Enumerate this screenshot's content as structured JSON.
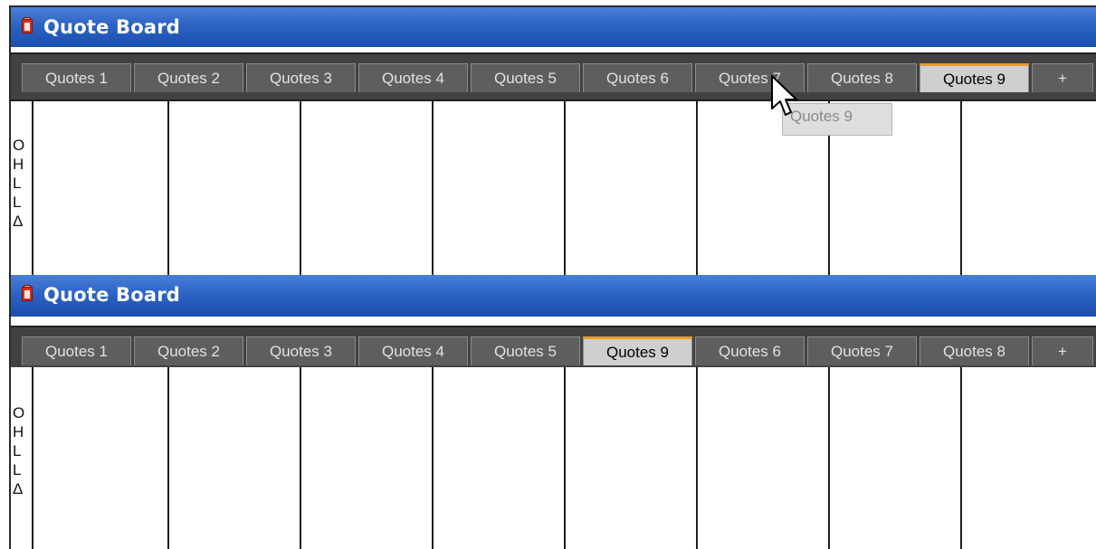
{
  "boards": [
    {
      "title": "Quote Board",
      "tabs": [
        "Quotes 1",
        "Quotes 2",
        "Quotes 3",
        "Quotes 4",
        "Quotes 5",
        "Quotes 6",
        "Quotes 7",
        "Quotes 8",
        "Quotes 9",
        "+"
      ],
      "active_tab": "Quotes 9",
      "row_labels": [
        "O",
        "H",
        "L",
        "L",
        "Δ"
      ]
    },
    {
      "title": "Quote Board",
      "tabs": [
        "Quotes 1",
        "Quotes 2",
        "Quotes 3",
        "Quotes 4",
        "Quotes 5",
        "Quotes 9",
        "Quotes 6",
        "Quotes 7",
        "Quotes 8",
        "+"
      ],
      "active_tab": "Quotes 9",
      "row_labels": [
        "O",
        "H",
        "L",
        "L",
        "Δ"
      ]
    }
  ],
  "drag_ghost_label": "Quotes 9",
  "colors": {
    "titlebar": "#2c63c4",
    "tabstrip": "#424242",
    "tab": "#5e5e5e",
    "tab_active": "#cfcfcf",
    "tab_active_accent": "#e69a2e"
  },
  "icons": [
    "quote-board-app-icon",
    "mouse-pointer-icon"
  ]
}
